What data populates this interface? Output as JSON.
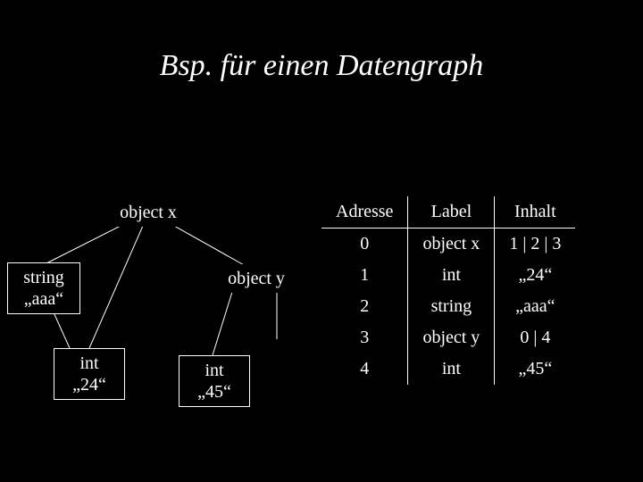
{
  "title": "Bsp. für einen Datengraph",
  "nodes": {
    "objectx": "object x",
    "string": "string\n„aaa“",
    "objecty": "object y",
    "int24": "int\n„24“",
    "int45": "int\n„45“"
  },
  "table": {
    "headers": {
      "addr": "Adresse",
      "label": "Label",
      "content": "Inhalt"
    },
    "rows": [
      {
        "addr": "0",
        "label": "object x",
        "content": "1 | 2 | 3"
      },
      {
        "addr": "1",
        "label": "int",
        "content": "„24“"
      },
      {
        "addr": "2",
        "label": "string",
        "content": "„aaa“"
      },
      {
        "addr": "3",
        "label": "object y",
        "content": "0 | 4"
      },
      {
        "addr": "4",
        "label": "int",
        "content": "„45“"
      }
    ]
  }
}
